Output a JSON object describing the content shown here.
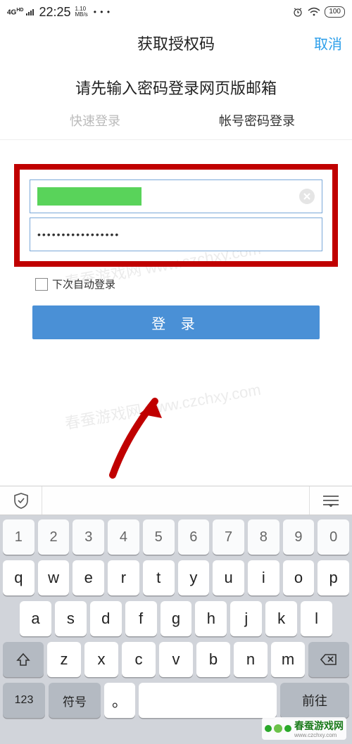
{
  "status": {
    "network": "4G",
    "network_sup": "HD",
    "time": "22:25",
    "speed_top": "1.10",
    "speed_bot": "MB/s",
    "dots": "• • •",
    "battery": "100"
  },
  "nav": {
    "title": "获取授权码",
    "cancel": "取消"
  },
  "subtitle": "请先输入密码登录网页版邮箱",
  "tabs": {
    "quick": "快速登录",
    "account": "帐号密码登录"
  },
  "form": {
    "password_dots": "•••••••••••••••••",
    "auto_login": "下次自动登录",
    "login_btn": "登 录"
  },
  "watermark1": "春蚕游戏网 www.czchxy.com",
  "watermark2": "春蚕游戏网 www.czchxy.com",
  "kb": {
    "nums": [
      "1",
      "2",
      "3",
      "4",
      "5",
      "6",
      "7",
      "8",
      "9",
      "0"
    ],
    "row1": [
      "q",
      "w",
      "e",
      "r",
      "t",
      "y",
      "u",
      "i",
      "o",
      "p"
    ],
    "row2": [
      "a",
      "s",
      "d",
      "f",
      "g",
      "h",
      "j",
      "k",
      "l"
    ],
    "row3": [
      "z",
      "x",
      "c",
      "v",
      "b",
      "n",
      "m"
    ],
    "k123": "123",
    "ksym": "符号",
    "kdot": "。",
    "kgo": "前往"
  },
  "brand": {
    "name": "春蚕游戏网",
    "url": "www.czchxy.com"
  }
}
